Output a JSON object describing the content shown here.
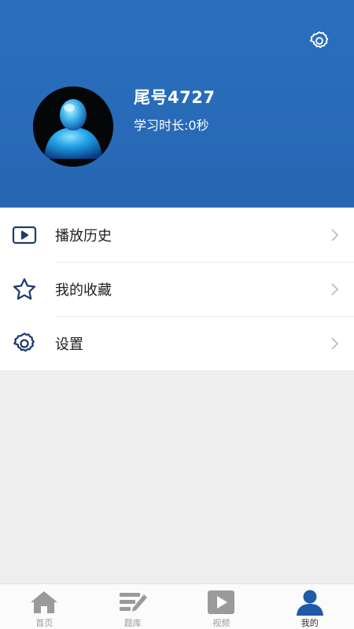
{
  "header": {
    "username": "尾号4727",
    "study_time": "学习时长:0秒"
  },
  "icons": {
    "settings_top": "gear-icon",
    "avatar": "user-avatar-icon"
  },
  "menu": {
    "items": [
      {
        "label": "播放历史",
        "icon": "play-history-icon"
      },
      {
        "label": "我的收藏",
        "icon": "star-icon"
      },
      {
        "label": "设置",
        "icon": "gear-icon"
      }
    ]
  },
  "tabbar": {
    "tabs": [
      {
        "label": "首页",
        "icon": "home-icon",
        "active": false
      },
      {
        "label": "题库",
        "icon": "question-bank-icon",
        "active": false
      },
      {
        "label": "视频",
        "icon": "video-icon",
        "active": false
      },
      {
        "label": "我的",
        "icon": "profile-icon",
        "active": true
      }
    ]
  },
  "colors": {
    "header_blue": "#2a6fbe",
    "icon_navy": "#1d3b6e",
    "tab_inactive": "#9a9a9a",
    "tab_active": "#1f5aa6"
  }
}
